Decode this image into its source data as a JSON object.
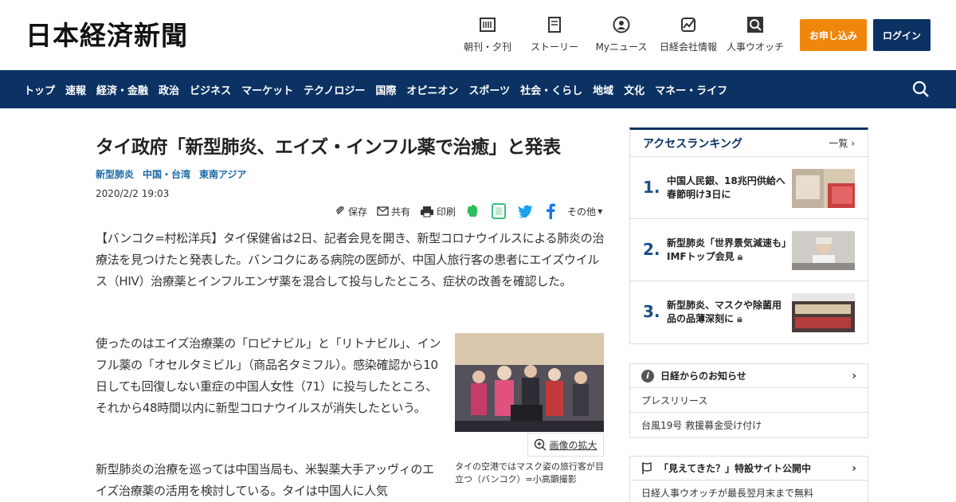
{
  "header": {
    "logo": "日本経済新聞",
    "links": [
      {
        "label": "朝刊・夕刊",
        "icon": "newspaper-icon"
      },
      {
        "label": "ストーリー",
        "icon": "bookmark-icon"
      },
      {
        "label": "Myニュース",
        "icon": "user-icon"
      },
      {
        "label": "日経会社情報",
        "icon": "chart-icon"
      },
      {
        "label": "人事ウオッチ",
        "icon": "search-person-icon"
      }
    ],
    "apply_label": "お申し込み",
    "login_label": "ログイン"
  },
  "nav": {
    "items": [
      "トップ",
      "速報",
      "経済・金融",
      "政治",
      "ビジネス",
      "マーケット",
      "テクノロジー",
      "国際",
      "オピニオン",
      "スポーツ",
      "社会・くらし",
      "地域",
      "文化",
      "マネー・ライフ"
    ]
  },
  "article": {
    "title": "タイ政府「新型肺炎、エイズ・インフル薬で治癒」と発表",
    "tags": [
      "新型肺炎",
      "中国・台湾",
      "東南アジア"
    ],
    "date": "2020/2/2 19:03",
    "tools": {
      "save": "保存",
      "share": "共有",
      "print": "印刷",
      "other": "その他"
    },
    "paragraphs": [
      "【バンコク=村松洋兵】タイ保健省は2日、記者会見を開き、新型コロナウイルスによる肺炎の治療法を見つけたと発表した。バンコクにある病院の医師が、中国人旅行客の患者にエイズウイルス（HIV）治療薬とインフルエンザ薬を混合して投与したところ、症状の改善を確認した。",
      "使ったのはエイズ治療薬の「ロピナビル」と「リトナビル」、インフル薬の「オセルタミビル」（商品名タミフル）。感染確認から10日しても回復しない重症の中国人女性（71）に投与したところ、それから48時間以内に新型コロナウイルスが消失したという。",
      "新型肺炎の治療を巡っては中国当局も、米製薬大手アッヴィのエイズ治療薬の活用を検討している。タイは中国人に人気"
    ],
    "zoom_label": "画像の拡大",
    "caption": "タイの空港ではマスク姿の旅行客が目立つ（バンコク）=小高顕撮影"
  },
  "ranking": {
    "title": "アクセスランキング",
    "more": "一覧",
    "items": [
      {
        "num": "1.",
        "text": "中国人民銀、18兆円供給へ　春節明け3日に",
        "locked": false
      },
      {
        "num": "2.",
        "text": "新型肺炎「世界景気減速も」　IMFトップ会見",
        "locked": true
      },
      {
        "num": "3.",
        "text": "新型肺炎、マスクや除菌用品の品薄深刻に",
        "locked": true
      }
    ]
  },
  "notice": {
    "title": "日経からのお知らせ",
    "rows": [
      "プレスリリース",
      "台風19号 救援募金受け付け"
    ]
  },
  "special": {
    "title": "「見えてきた？」特設サイト公開中",
    "row": "日経人事ウオッチが最長翌月末まで無料"
  }
}
